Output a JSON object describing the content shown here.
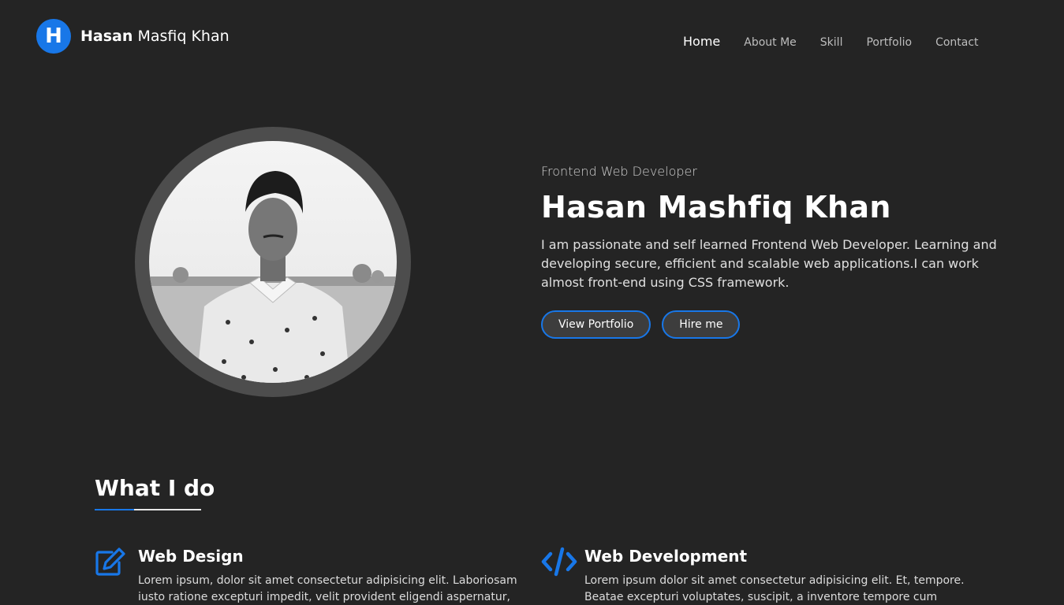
{
  "brand": {
    "initial": "H",
    "first": "Hasan",
    "rest": "Masfiq Khan"
  },
  "nav": [
    {
      "label": "Home",
      "active": true
    },
    {
      "label": "About Me"
    },
    {
      "label": "Skill"
    },
    {
      "label": "Portfolio"
    },
    {
      "label": "Contact"
    }
  ],
  "hero": {
    "subtitle": "Frontend Web Developer",
    "name": "Hasan Mashfiq Khan",
    "description": "I am passionate and self learned Frontend Web Developer. Learning and developing secure, efficient and scalable web applications.I can work almost front-end using CSS framework.",
    "buttons": {
      "portfolio": "View Portfolio",
      "hire": "Hire me"
    }
  },
  "services_section": {
    "title": "What I do",
    "items": [
      {
        "icon": "edit-icon",
        "title": "Web Design",
        "text": "Lorem ipsum, dolor sit amet consectetur adipisicing elit. Laboriosam iusto ratione excepturi impedit, velit provident eligendi aspernatur,"
      },
      {
        "icon": "code-icon",
        "title": "Web Development",
        "text": "Lorem ipsum dolor sit amet consectetur adipisicing elit. Et, tempore. Beatae excepturi voluptates, suscipit, a inventore tempore cum"
      }
    ]
  },
  "colors": {
    "accent": "#1877e8",
    "background": "#242424",
    "ring": "#4d4d4d"
  }
}
